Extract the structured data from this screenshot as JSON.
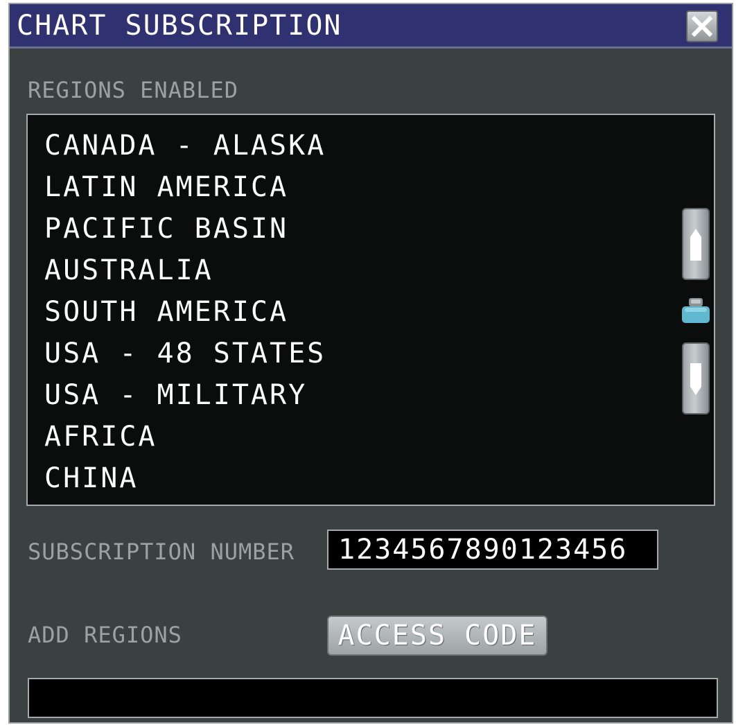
{
  "window": {
    "title": "CHART SUBSCRIPTION",
    "close_icon": "close-x-icon"
  },
  "regions": {
    "label": "REGIONS ENABLED",
    "items": [
      "CANADA - ALASKA",
      "LATIN AMERICA",
      "PACIFIC BASIN",
      "AUSTRALIA",
      "SOUTH AMERICA",
      "USA - 48 STATES",
      "USA - MILITARY",
      "AFRICA",
      "CHINA"
    ],
    "scroll_up_icon": "arrow-up-icon",
    "scroll_down_icon": "arrow-down-icon",
    "scroll_thumb_icon": "scroll-thumb-icon"
  },
  "subscription": {
    "label": "SUBSCRIPTION NUMBER",
    "value": "1234567890123456"
  },
  "add_regions": {
    "label": "ADD REGIONS",
    "button_label": "ACCESS CODE",
    "input_value": "",
    "input_placeholder": ""
  },
  "colors": {
    "title_bar": "#2f3170",
    "panel_background": "#3b4040",
    "list_background": "#0b0d0d",
    "label_text": "#9ca2a4",
    "value_text": "#ffffff",
    "button_face": "#b2b8ba",
    "scroll_thumb_accent": "#5fb8d0"
  }
}
